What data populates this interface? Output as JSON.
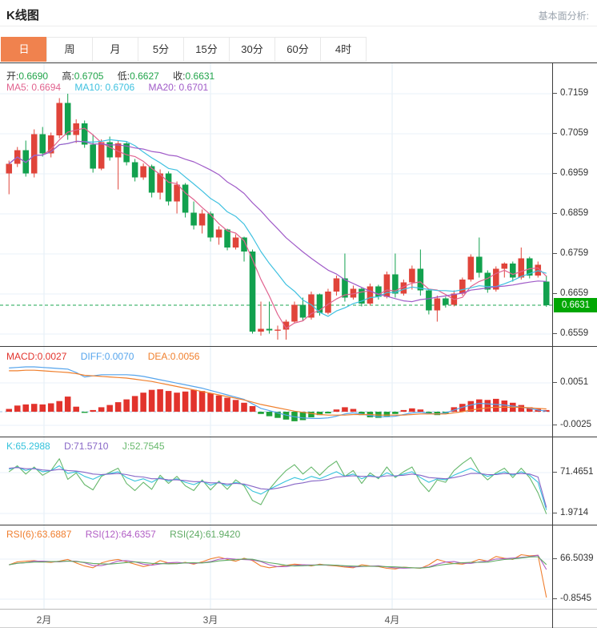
{
  "header": {
    "title": "K线图",
    "analysis_link": "基本面分析:"
  },
  "tabs": {
    "items": [
      "日",
      "周",
      "月",
      "5分",
      "15分",
      "30分",
      "60分",
      "4时"
    ],
    "selected": 0
  },
  "legend": {
    "ohlc": {
      "open_label": "开:",
      "open": "0.6690",
      "high_label": "高:",
      "high": "0.6705",
      "low_label": "低:",
      "low": "0.6627",
      "close_label": "收:",
      "close": "0.6631"
    },
    "ma": {
      "ma5_label": "MA5:",
      "ma5": "0.6694",
      "ma10_label": "MA10:",
      "ma10": "0.6706",
      "ma20_label": "MA20:",
      "ma20": "0.6701"
    },
    "macd": {
      "macd_label": "MACD:",
      "macd": "0.0027",
      "diff_label": "DIFF:",
      "diff": "0.0070",
      "dea_label": "DEA:",
      "dea": "0.0056"
    },
    "kdj": {
      "k_label": "K:",
      "k": "65.2988",
      "d_label": "D:",
      "d": "71.5710",
      "j_label": "J:",
      "j": "52.7545"
    },
    "rsi": {
      "rsi6_label": "RSI(6):",
      "rsi6": "63.6887",
      "rsi12_label": "RSI(12):",
      "rsi12": "64.6357",
      "rsi24_label": "RSI(24):",
      "rsi24": "61.9420"
    }
  },
  "axis": {
    "price_ticks": [
      "0.7159",
      "0.7059",
      "0.6959",
      "0.6859",
      "0.6759",
      "0.6659",
      "0.6559"
    ],
    "current_price": "0.6631",
    "macd_ticks": [
      "0.0051",
      "-0.0025"
    ],
    "kdj_ticks": [
      "71.4651",
      "1.9714"
    ],
    "rsi_ticks": [
      "66.5039",
      "-0.8545"
    ],
    "months": [
      "2月",
      "3月",
      "4月"
    ]
  },
  "colors": {
    "up": "#e0443a",
    "down": "#12a14e",
    "ma5": "#e1638f",
    "ma10": "#3fc1e0",
    "ma20": "#a05bc8",
    "macd_up": "#e2332c",
    "macd_down": "#1fa23a",
    "diff": "#55a4ec",
    "dea": "#f0812f",
    "k": "#35c3dc",
    "d": "#8766c6",
    "j": "#67b86c",
    "rsi6": "#f07e2e",
    "rsi12": "#b05cc4",
    "rsi24": "#5fab64",
    "price_line": "#1da750",
    "badge_bg": "#00a702",
    "accent": "#f0824e",
    "grid": "#eaf1f8",
    "grid_v": "#e2ecf5",
    "zero_dash": "#9cc7ee"
  },
  "chart_data": {
    "type": "candlestick+indicators",
    "title": "K线图 daily candlestick with MACD / KDJ / RSI sub-panels",
    "x_months": [
      "2月",
      "3月",
      "4月"
    ],
    "price_ylim": [
      0.6559,
      0.7159
    ],
    "price_ticks": [
      0.7159,
      0.7059,
      0.6959,
      0.6859,
      0.6759,
      0.6659,
      0.6559
    ],
    "current_price": 0.6631,
    "candles_format": [
      "open",
      "high",
      "low",
      "close"
    ],
    "candles": [
      [
        0.696,
        0.6992,
        0.6908,
        0.6984
      ],
      [
        0.6984,
        0.7026,
        0.6976,
        0.7018
      ],
      [
        0.7018,
        0.7042,
        0.6952,
        0.696
      ],
      [
        0.696,
        0.707,
        0.695,
        0.7058
      ],
      [
        0.7058,
        0.7076,
        0.7002,
        0.701
      ],
      [
        0.701,
        0.7062,
        0.7,
        0.7055
      ],
      [
        0.7055,
        0.7148,
        0.7048,
        0.7136
      ],
      [
        0.7136,
        0.7159,
        0.7044,
        0.7056
      ],
      [
        0.7056,
        0.7095,
        0.7036,
        0.7085
      ],
      [
        0.7085,
        0.7092,
        0.7024,
        0.7032
      ],
      [
        0.7032,
        0.7058,
        0.6962,
        0.6972
      ],
      [
        0.6972,
        0.7045,
        0.6968,
        0.7038
      ],
      [
        0.7038,
        0.7052,
        0.6992,
        0.7
      ],
      [
        0.7,
        0.7042,
        0.692,
        0.7035
      ],
      [
        0.7035,
        0.704,
        0.698,
        0.6988
      ],
      [
        0.6988,
        0.6996,
        0.694,
        0.695
      ],
      [
        0.695,
        0.6985,
        0.6944,
        0.6978
      ],
      [
        0.6978,
        0.6982,
        0.69,
        0.6912
      ],
      [
        0.6912,
        0.697,
        0.6895,
        0.696
      ],
      [
        0.696,
        0.6965,
        0.688,
        0.689
      ],
      [
        0.689,
        0.694,
        0.686,
        0.6932
      ],
      [
        0.6932,
        0.6936,
        0.685,
        0.6862
      ],
      [
        0.6862,
        0.689,
        0.682,
        0.683
      ],
      [
        0.683,
        0.687,
        0.681,
        0.686
      ],
      [
        0.686,
        0.6865,
        0.679,
        0.68
      ],
      [
        0.68,
        0.6828,
        0.6782,
        0.682
      ],
      [
        0.682,
        0.6822,
        0.6768,
        0.6775
      ],
      [
        0.6775,
        0.6808,
        0.677,
        0.68
      ],
      [
        0.68,
        0.6802,
        0.674,
        0.6765
      ],
      [
        0.6765,
        0.677,
        0.656,
        0.6565
      ],
      [
        0.6565,
        0.664,
        0.6555,
        0.6572
      ],
      [
        0.6572,
        0.664,
        0.656,
        0.6568
      ],
      [
        0.6568,
        0.658,
        0.6545,
        0.657
      ],
      [
        0.657,
        0.6595,
        0.6545,
        0.659
      ],
      [
        0.659,
        0.664,
        0.6585,
        0.6632
      ],
      [
        0.6632,
        0.665,
        0.6592,
        0.66
      ],
      [
        0.66,
        0.6665,
        0.6595,
        0.6658
      ],
      [
        0.6658,
        0.666,
        0.6605,
        0.6612
      ],
      [
        0.6612,
        0.6672,
        0.6608,
        0.6665
      ],
      [
        0.6665,
        0.6705,
        0.6655,
        0.6698
      ],
      [
        0.6698,
        0.676,
        0.664,
        0.665
      ],
      [
        0.665,
        0.668,
        0.6645,
        0.6672
      ],
      [
        0.6672,
        0.6676,
        0.6628,
        0.6635
      ],
      [
        0.6635,
        0.6685,
        0.663,
        0.6678
      ],
      [
        0.6678,
        0.6682,
        0.6645,
        0.6652
      ],
      [
        0.6652,
        0.6715,
        0.6648,
        0.6708
      ],
      [
        0.6708,
        0.676,
        0.665,
        0.666
      ],
      [
        0.666,
        0.6695,
        0.6655,
        0.6688
      ],
      [
        0.6688,
        0.673,
        0.667,
        0.6722
      ],
      [
        0.6722,
        0.677,
        0.6655,
        0.6668
      ],
      [
        0.6668,
        0.6672,
        0.6608,
        0.6618
      ],
      [
        0.6618,
        0.6655,
        0.659,
        0.6648
      ],
      [
        0.6648,
        0.6652,
        0.6625,
        0.6632
      ],
      [
        0.6632,
        0.6668,
        0.6628,
        0.666
      ],
      [
        0.666,
        0.67,
        0.6655,
        0.6695
      ],
      [
        0.6695,
        0.6758,
        0.669,
        0.6752
      ],
      [
        0.6752,
        0.68,
        0.67,
        0.6712
      ],
      [
        0.6712,
        0.6718,
        0.6662,
        0.667
      ],
      [
        0.667,
        0.6728,
        0.6665,
        0.6722
      ],
      [
        0.6722,
        0.6738,
        0.67,
        0.6735
      ],
      [
        0.6735,
        0.674,
        0.669,
        0.67
      ],
      [
        0.67,
        0.6775,
        0.6695,
        0.6748
      ],
      [
        0.6748,
        0.6752,
        0.6698,
        0.6705
      ],
      [
        0.6705,
        0.674,
        0.67,
        0.6732
      ],
      [
        0.669,
        0.6705,
        0.6627,
        0.6631
      ]
    ],
    "macd": {
      "ticks": [
        0.0051,
        -0.0025
      ],
      "hist": [
        0.0005,
        0.0011,
        0.0013,
        0.0014,
        0.0013,
        0.0015,
        0.0019,
        0.0027,
        0.0009,
        -0.0002,
        0.0003,
        0.0008,
        0.0012,
        0.0017,
        0.0022,
        0.0028,
        0.0034,
        0.0039,
        0.004,
        0.0037,
        0.0034,
        0.0036,
        0.0039,
        0.0037,
        0.0033,
        0.0029,
        0.0025,
        0.0021,
        0.0016,
        0.001,
        -0.0004,
        -0.0008,
        -0.0011,
        -0.0014,
        -0.0017,
        -0.0015,
        -0.001,
        -0.0006,
        -0.0003,
        0.0004,
        0.0008,
        0.0005,
        -0.0006,
        -0.001,
        -0.0011,
        -0.0008,
        -0.0004,
        0.0003,
        0.0006,
        0.0004,
        -0.0003,
        -0.0006,
        -0.0004,
        0.0008,
        0.0014,
        0.0019,
        0.0022,
        0.0021,
        0.0023,
        0.002,
        0.0016,
        0.0012,
        0.0008,
        0.0005,
        0.0003
      ],
      "diff": [
        0.0078,
        0.0079,
        0.008,
        0.008,
        0.0079,
        0.0078,
        0.0077,
        0.0076,
        0.007,
        0.0062,
        0.0064,
        0.0066,
        0.0066,
        0.0066,
        0.0066,
        0.0065,
        0.0063,
        0.006,
        0.0057,
        0.0054,
        0.0051,
        0.0048,
        0.0045,
        0.0042,
        0.0038,
        0.0034,
        0.003,
        0.0026,
        0.0022,
        0.0014,
        0.0006,
        0.0002,
        -0.0002,
        -0.0006,
        -0.0009,
        -0.0011,
        -0.0012,
        -0.0012,
        -0.0011,
        -0.0008,
        -0.0004,
        -0.0002,
        -0.0004,
        -0.0007,
        -0.0009,
        -0.0009,
        -0.0008,
        -0.0005,
        -0.0002,
        -0.0001,
        -0.0003,
        -0.0004,
        -0.0002,
        0.0003,
        0.0008,
        0.0012,
        0.0015,
        0.0014,
        0.0013,
        0.0012,
        0.001,
        0.0008,
        0.0006,
        0.0003,
        0.0001
      ],
      "dea": [
        0.0073,
        0.0073,
        0.0074,
        0.0074,
        0.0073,
        0.0072,
        0.0071,
        0.007,
        0.0068,
        0.0065,
        0.0064,
        0.0063,
        0.0062,
        0.0061,
        0.006,
        0.0058,
        0.0056,
        0.0054,
        0.0051,
        0.0048,
        0.0045,
        0.0042,
        0.0039,
        0.0036,
        0.0033,
        0.003,
        0.0027,
        0.0024,
        0.0021,
        0.0017,
        0.0013,
        0.001,
        0.0007,
        0.0004,
        0.0001,
        -0.0001,
        -0.0003,
        -0.0005,
        -0.0006,
        -0.0006,
        -0.0006,
        -0.0005,
        -0.0005,
        -0.0005,
        -0.0006,
        -0.0006,
        -0.0006,
        -0.0006,
        -0.0005,
        -0.0004,
        -0.0004,
        -0.0004,
        -0.0004,
        -0.0002,
        0.0,
        0.0003,
        0.0005,
        0.0007,
        0.0008,
        0.0008,
        0.0008,
        0.0008,
        0.0007,
        0.0006,
        0.0005
      ]
    },
    "kdj": {
      "ticks": [
        71.4651,
        1.9714
      ],
      "k": [
        77,
        81,
        75,
        79,
        73,
        75,
        83,
        70,
        73,
        65,
        60,
        67,
        70,
        73,
        63,
        57,
        61,
        55,
        63,
        57,
        61,
        55,
        51,
        57,
        50,
        55,
        49,
        55,
        51,
        40,
        35,
        43,
        50,
        57,
        63,
        59,
        65,
        61,
        67,
        73,
        65,
        69,
        61,
        67,
        63,
        71,
        65,
        69,
        73,
        63,
        55,
        61,
        59,
        67,
        73,
        79,
        71,
        65,
        69,
        73,
        67,
        73,
        67,
        55,
        8
      ],
      "d": [
        79,
        80,
        78,
        78,
        76,
        75,
        77,
        75,
        74,
        72,
        69,
        68,
        69,
        70,
        68,
        65,
        64,
        61,
        61,
        59,
        59,
        58,
        56,
        56,
        54,
        54,
        52,
        53,
        52,
        48,
        44,
        43,
        45,
        48,
        52,
        54,
        57,
        58,
        60,
        64,
        65,
        66,
        65,
        65,
        64,
        66,
        66,
        67,
        69,
        67,
        63,
        62,
        61,
        63,
        66,
        70,
        70,
        68,
        68,
        70,
        69,
        70,
        69,
        64,
        12
      ]
    },
    "rsi": {
      "ticks": [
        66.5039,
        -0.8545
      ],
      "rsi6": [
        57,
        62,
        63,
        64,
        62,
        61,
        63,
        66,
        60,
        55,
        52,
        60,
        64,
        66,
        62,
        58,
        54,
        57,
        64,
        60,
        59,
        61,
        58,
        62,
        67,
        70,
        66,
        63,
        68,
        64,
        55,
        52,
        54,
        56,
        58,
        57,
        55,
        58,
        56,
        55,
        53,
        52,
        57,
        55,
        54,
        51,
        50,
        53,
        52,
        51,
        57,
        66,
        62,
        59,
        58,
        61,
        66,
        63,
        71,
        68,
        66,
        74,
        72,
        73,
        2
      ]
    }
  }
}
